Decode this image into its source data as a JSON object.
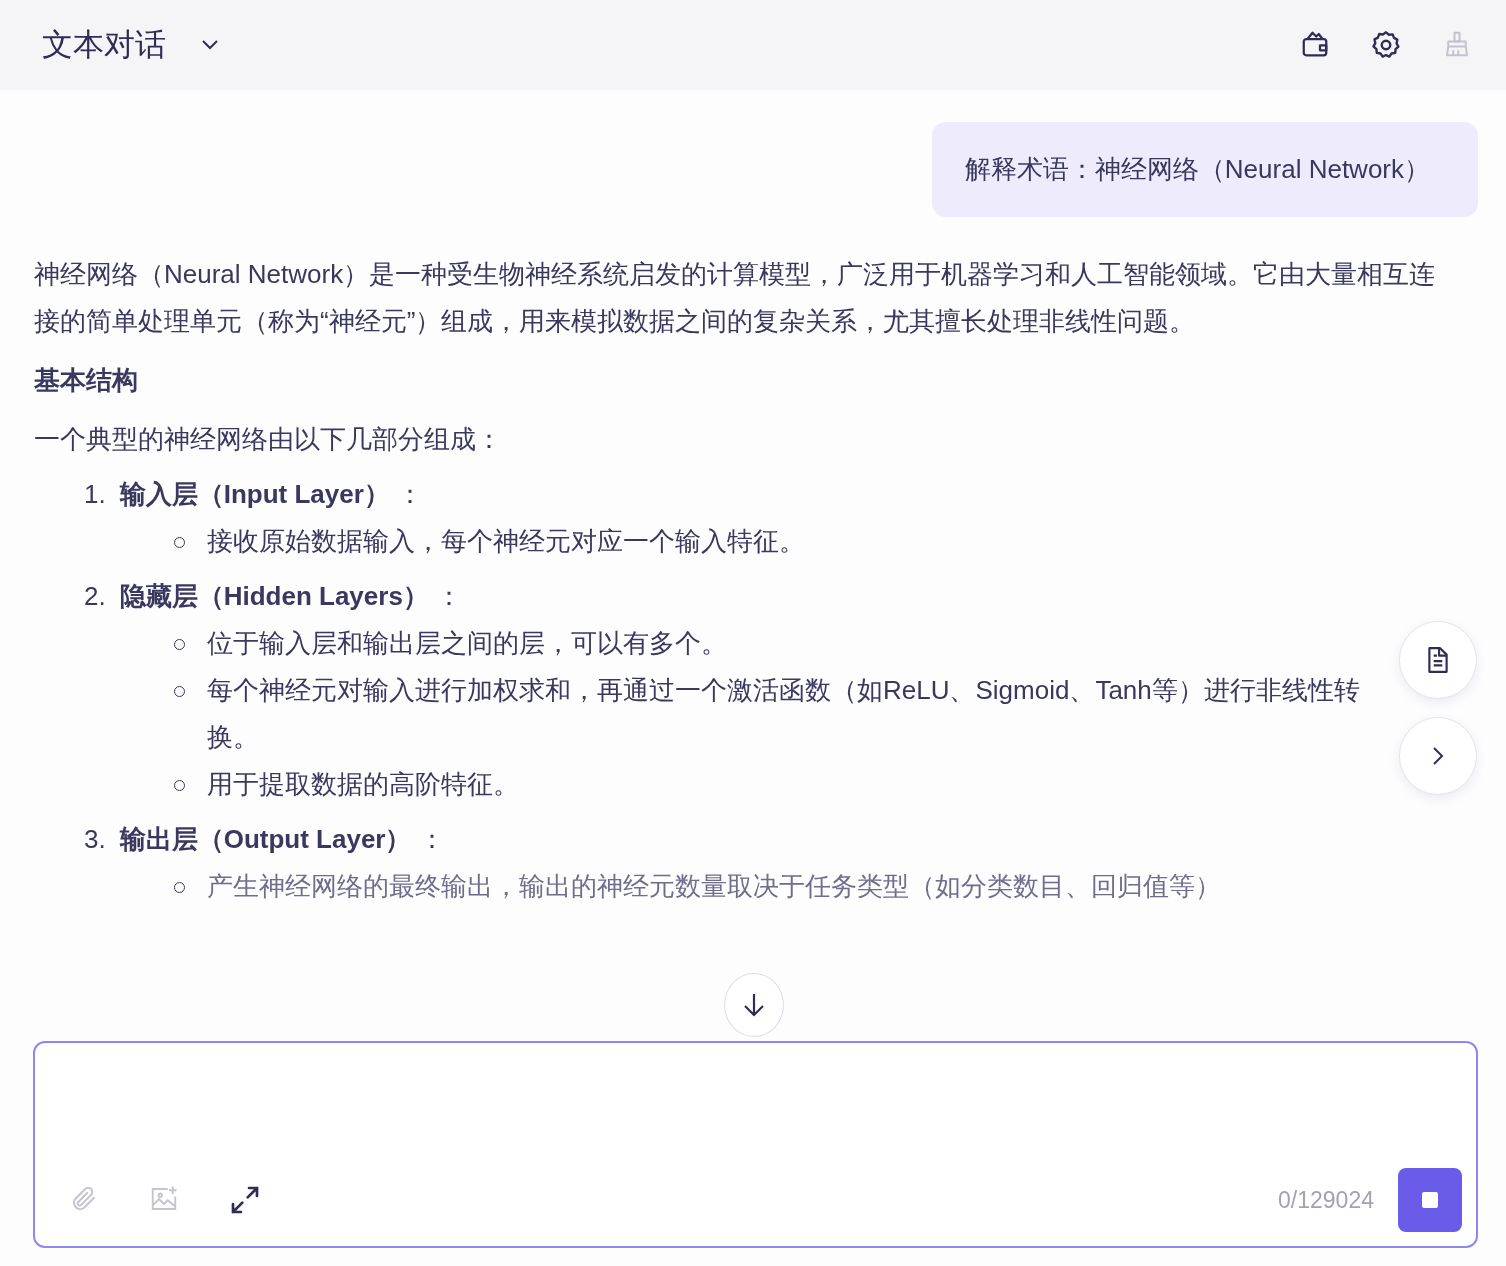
{
  "header": {
    "title": "文本对话",
    "actions": [
      {
        "disabled": false
      },
      {
        "disabled": false
      },
      {
        "disabled": true
      }
    ]
  },
  "user_message": "解释术语：神经网络（Neural Network）",
  "answer": {
    "intro": "神经网络（Neural Network）是一种受生物神经系统启发的计算模型，广泛用于机器学习和人工智能领域。它由大量相互连接的简单处理单元（称为“神经元”）组成，用来模拟数据之间的复杂关系，尤其擅长处理非线性问题。",
    "heading": "基本结构",
    "lead": "一个典型的神经网络由以下几部分组成：",
    "sections": [
      {
        "number": "1.",
        "title": "**输入层（Input Layer）** ：",
        "bullets": [
          "接收原始数据输入，每个神经元对应一个输入特征。"
        ]
      },
      {
        "number": "2.",
        "title": "**隐藏层（Hidden Layers）** ：",
        "bullets": [
          "位于输入层和输出层之间的层，可以有多个。",
          "每个神经元对输入进行加权求和，再通过一个激活函数（如ReLU、Sigmoid、Tanh等）进行非线性转换。",
          "用于提取数据的高阶特征。"
        ]
      },
      {
        "number": "3.",
        "title": "**输出层（Output Layer）** ：",
        "bullets": [
          "产生神经网络的最终输出，输出的神经元数量取决于任务类型（如分类数目、回归值等）"
        ]
      }
    ]
  },
  "composer": {
    "counter": "0/129024",
    "tools": [
      {
        "disabled": true
      },
      {
        "disabled": true
      },
      {
        "disabled": false
      }
    ]
  }
}
